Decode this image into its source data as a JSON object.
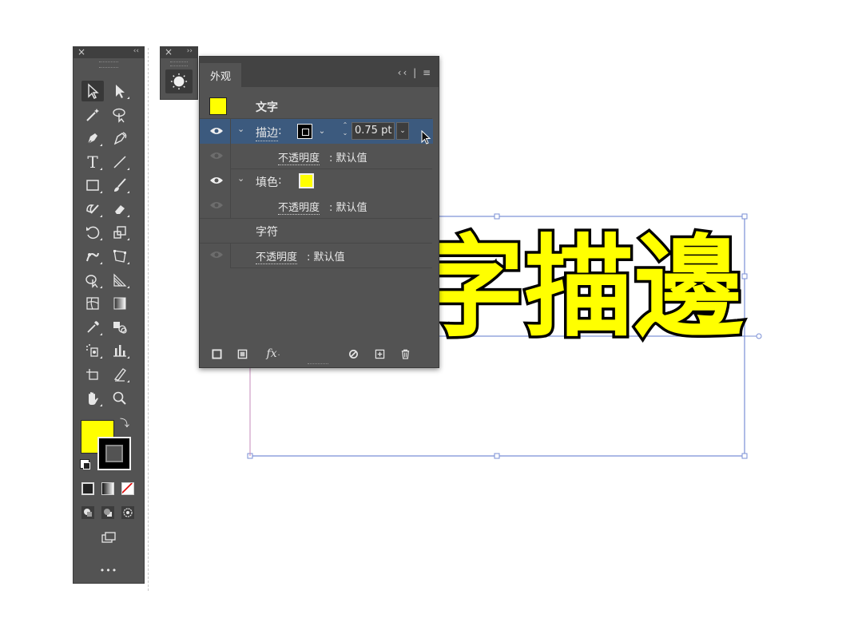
{
  "canvas": {
    "artwork_text": "字描邊",
    "fill_color": "#ffff00",
    "stroke_color": "#000000",
    "bbox_color": "#7a8fd6"
  },
  "tools_panel": {
    "close_glyph": "×",
    "collapse_glyph": "‹‹",
    "more_label": "•••",
    "fill_color": "#ffff00",
    "stroke_color": "#000000"
  },
  "mini_panel": {
    "close_glyph": "×",
    "expand_glyph": "››"
  },
  "appearance": {
    "tab_label": "外观",
    "tab_controls": "‹‹ | ≡",
    "rows": {
      "title": "文字",
      "stroke_label": "描边",
      "stroke_colon": ":",
      "stroke_weight": "0.75 pt",
      "stroke_opacity_label": "不透明度",
      "stroke_opacity_value": ": 默认值",
      "fill_label": "填色",
      "fill_colon": ":",
      "fill_opacity_label": "不透明度",
      "fill_opacity_value": ": 默认值",
      "chars_label": "字符",
      "char_opacity_label": "不透明度",
      "char_opacity_value": ": 默认值"
    },
    "fx_label": "fx",
    "colors": {
      "panel_bg": "#535353",
      "highlight": "#3c5a7e",
      "fill_swatch": "#ffff00"
    }
  }
}
